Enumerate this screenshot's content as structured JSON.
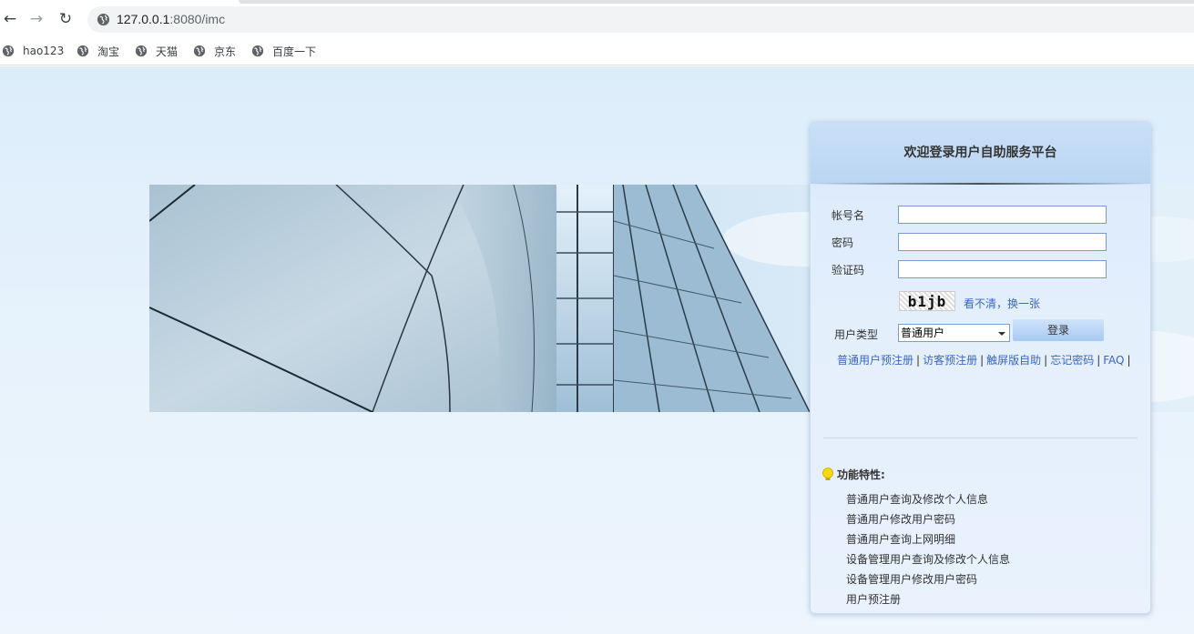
{
  "browser": {
    "url_host": "127.0.0.1",
    "url_path": ":8080/imc",
    "bookmarks": [
      "hao123",
      "淘宝",
      "天猫",
      "京东",
      "百度一下"
    ]
  },
  "login": {
    "title": "欢迎登录用户自助服务平台",
    "account_label": "帐号名",
    "password_label": "密码",
    "captcha_label": "验证码",
    "captcha_text": "b1jb",
    "captcha_refresh": "看不清，换一张",
    "user_type_label": "用户类型",
    "user_type_value": "普通用户",
    "login_button": "登录",
    "links": [
      "普通用户预注册",
      "访客预注册",
      "触屏版自助",
      "忘记密码",
      "FAQ"
    ],
    "link_separator": "|"
  },
  "features": {
    "heading": "功能特性:",
    "items": [
      "普通用户查询及修改个人信息",
      "普通用户修改用户密码",
      "普通用户查询上网明细",
      "设备管理用户查询及修改个人信息",
      "设备管理用户修改用户密码",
      "用户预注册"
    ]
  }
}
